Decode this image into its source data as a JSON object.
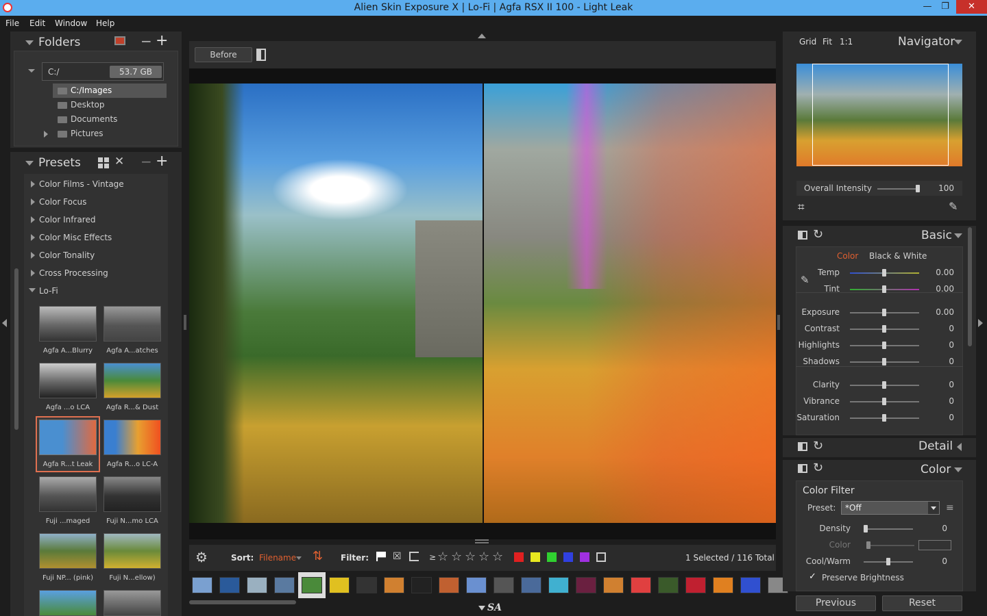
{
  "window": {
    "title": "Alien Skin Exposure X | Lo-Fi | Agfa RSX II 100 - Light Leak",
    "minimize": "—",
    "maximize": "❐",
    "close": "✕"
  },
  "menu": [
    "File",
    "Edit",
    "Window",
    "Help"
  ],
  "folders": {
    "title": "Folders",
    "minus": "−",
    "plus": "+",
    "drive": "C:/",
    "size": "53.7 GB",
    "items": [
      "C:/Images",
      "Desktop",
      "Documents",
      "Pictures"
    ]
  },
  "presets": {
    "title": "Presets",
    "minus": "−",
    "plus": "+",
    "categories": [
      "Color Films - Vintage",
      "Color Focus",
      "Color Infrared",
      "Color Misc Effects",
      "Color Tonality",
      "Cross Processing",
      "Lo-Fi"
    ],
    "thumbs": [
      "Agfa A...Blurry",
      "Agfa A...atches",
      "Agfa ...o LCA",
      "Agfa R...& Dust",
      "Agfa R...t Leak",
      "Agfa R...o LC-A",
      "Fuji ...maged",
      "Fuji N...mo LCA",
      "Fuji NP... (pink)",
      "Fuji N...ellow)"
    ]
  },
  "viewer": {
    "before_label": "Before"
  },
  "toolbar": {
    "sort_label": "Sort:",
    "sort_value": "Filename",
    "filter_label": "Filter:",
    "rating_prefix": "≥",
    "status": "1 Selected / 116 Total",
    "colors": [
      "#e02020",
      "#e8e820",
      "#30d030",
      "#3040e0",
      "#a030e0"
    ]
  },
  "navigator": {
    "title": "Navigator",
    "grid": "Grid",
    "fit": "Fit",
    "one": "1:1",
    "intensity_label": "Overall Intensity",
    "intensity_value": "100",
    "intensity": 1.0
  },
  "basic": {
    "title": "Basic",
    "tab_color": "Color",
    "tab_bw": "Black & White",
    "rows": [
      {
        "label": "Temp",
        "value": "0.00"
      },
      {
        "label": "Tint",
        "value": "0.00"
      },
      {
        "label": "Exposure",
        "value": "0.00"
      },
      {
        "label": "Contrast",
        "value": "0"
      },
      {
        "label": "Highlights",
        "value": "0"
      },
      {
        "label": "Shadows",
        "value": "0"
      },
      {
        "label": "Clarity",
        "value": "0"
      },
      {
        "label": "Vibrance",
        "value": "0"
      },
      {
        "label": "Saturation",
        "value": "0"
      }
    ]
  },
  "detail": {
    "title": "Detail"
  },
  "color": {
    "title": "Color",
    "filter_title": "Color Filter",
    "preset_label": "Preset:",
    "preset_value": "*Off",
    "density_label": "Density",
    "density_value": "0",
    "color_label": "Color",
    "coolwarm_label": "Cool/Warm",
    "coolwarm_value": "0",
    "preserve_label": "Preserve Brightness"
  },
  "footer": {
    "previous": "Previous",
    "reset": "Reset",
    "logo": "SA"
  }
}
